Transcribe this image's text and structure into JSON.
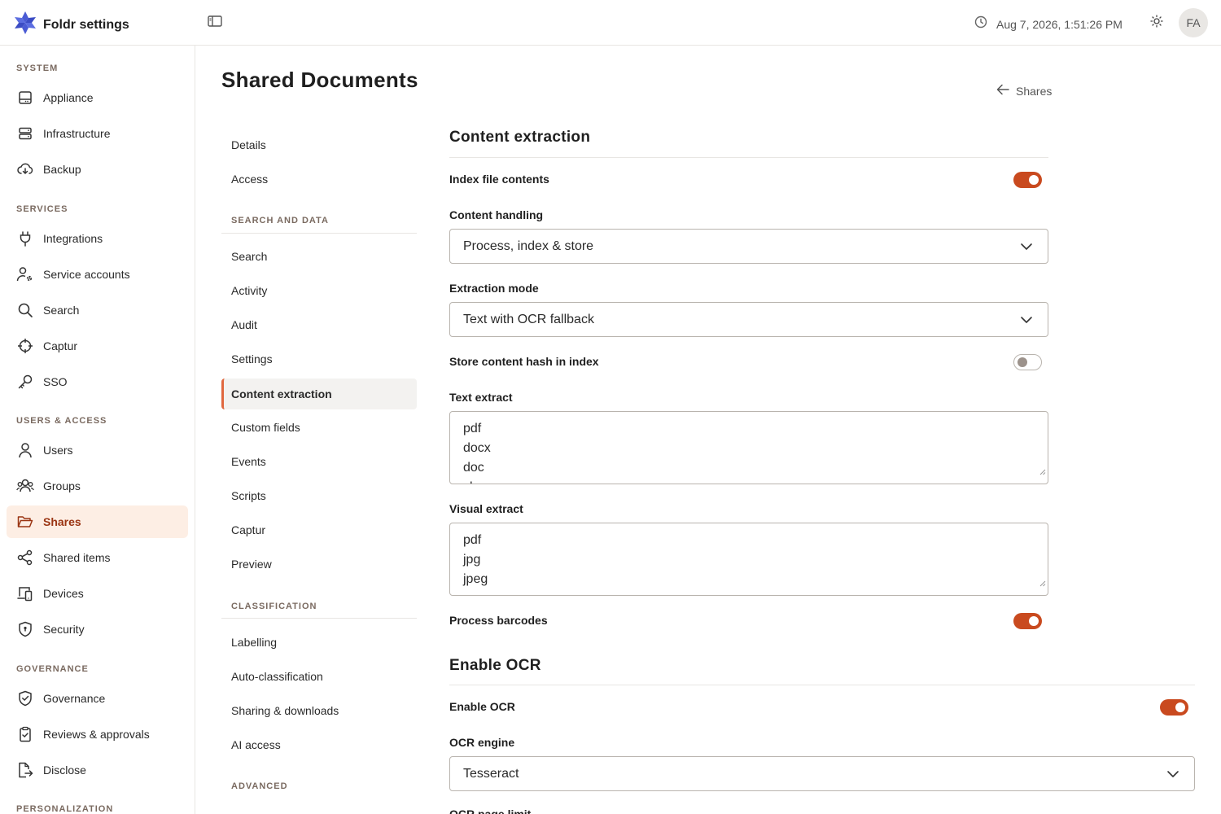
{
  "header": {
    "title": "Foldr settings",
    "datetime": "Aug 7, 2026, 1:51:26 PM",
    "avatar_initials": "FA"
  },
  "sidebar": {
    "sections": [
      {
        "label": "SYSTEM",
        "items": [
          {
            "label": "Appliance",
            "icon": "appliance-icon"
          },
          {
            "label": "Infrastructure",
            "icon": "server-icon"
          },
          {
            "label": "Backup",
            "icon": "cloud-download-icon"
          }
        ]
      },
      {
        "label": "SERVICES",
        "items": [
          {
            "label": "Integrations",
            "icon": "plug-icon"
          },
          {
            "label": "Service accounts",
            "icon": "user-gear-icon"
          },
          {
            "label": "Search",
            "icon": "search-icon"
          },
          {
            "label": "Captur",
            "icon": "crosshair-icon"
          },
          {
            "label": "SSO",
            "icon": "key-icon"
          }
        ]
      },
      {
        "label": "USERS & ACCESS",
        "items": [
          {
            "label": "Users",
            "icon": "user-icon"
          },
          {
            "label": "Groups",
            "icon": "users-icon"
          },
          {
            "label": "Shares",
            "icon": "folder-open-icon",
            "active": true
          },
          {
            "label": "Shared items",
            "icon": "share-icon"
          },
          {
            "label": "Devices",
            "icon": "devices-icon"
          },
          {
            "label": "Security",
            "icon": "shield-keyhole-icon"
          }
        ]
      },
      {
        "label": "GOVERNANCE",
        "items": [
          {
            "label": "Governance",
            "icon": "shield-check-icon"
          },
          {
            "label": "Reviews & approvals",
            "icon": "clipboard-check-icon"
          },
          {
            "label": "Disclose",
            "icon": "file-export-icon"
          }
        ]
      },
      {
        "label": "PERSONALIZATION",
        "items": []
      }
    ]
  },
  "main": {
    "title": "Shared Documents",
    "back_link": "Shares"
  },
  "subnav": {
    "top_items": [
      "Details",
      "Access"
    ],
    "search_section": "SEARCH AND DATA",
    "search_items": [
      "Search",
      "Activity",
      "Audit",
      "Settings",
      "Content extraction",
      "Custom fields",
      "Events",
      "Scripts",
      "Captur",
      "Preview"
    ],
    "active": "Content extraction",
    "classification_section": "CLASSIFICATION",
    "classification_items": [
      "Labelling",
      "Auto-classification",
      "Sharing & downloads",
      "AI access"
    ],
    "advanced_section": "ADVANCED"
  },
  "content": {
    "extraction_title": "Content extraction",
    "index_file_contents": {
      "label": "Index file contents",
      "enabled": true
    },
    "content_handling": {
      "label": "Content handling",
      "value": "Process, index & store"
    },
    "extraction_mode": {
      "label": "Extraction mode",
      "value": "Text with OCR fallback"
    },
    "store_hash": {
      "label": "Store content hash in index",
      "enabled": false
    },
    "text_extract": {
      "label": "Text extract",
      "lines": [
        "pdf",
        "docx",
        "doc",
        "xls"
      ]
    },
    "visual_extract": {
      "label": "Visual extract",
      "lines": [
        "pdf",
        "jpg",
        "jpeg"
      ]
    },
    "process_barcodes": {
      "label": "Process barcodes",
      "enabled": true
    },
    "ocr_title": "Enable OCR",
    "enable_ocr": {
      "label": "Enable OCR",
      "enabled": true
    },
    "ocr_engine": {
      "label": "OCR engine",
      "value": "Tesseract"
    },
    "ocr_page_limit_label": "OCR page limit"
  },
  "colors": {
    "accent": "#c94a1f",
    "active_bg": "#fdeee4",
    "active_text": "#9a3412",
    "brand": "#4a5bd4"
  }
}
